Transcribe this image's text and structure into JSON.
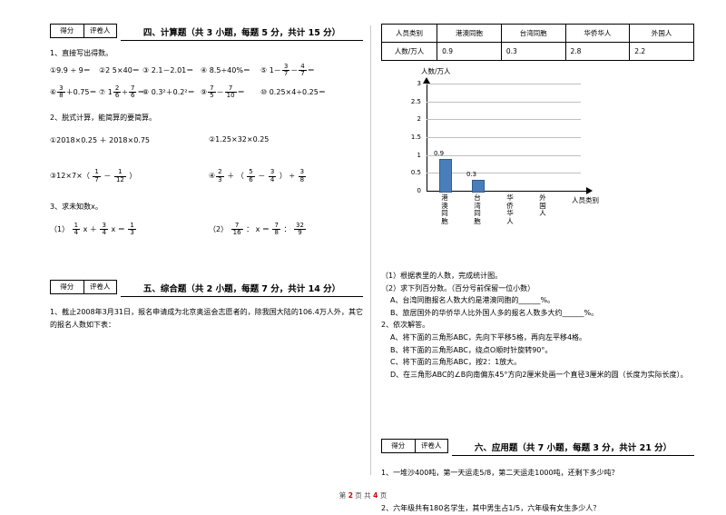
{
  "sections": {
    "four": {
      "score_label": "得分",
      "marker_label": "评卷人",
      "title": "四、计算题（共 3 小题，每题 5 分，共计 15 分）",
      "q1": "1、直接写出得数。",
      "q1_items_line1": [
        "①9.9 ÷ 9＝",
        "②2 5×40＝",
        "③ 2.1－2.01＝",
        "④ 8.5÷40%＝",
        "⑤ 1－ 3/7 － 4/7 ＝"
      ],
      "q1_items_line2": [
        "⑥ 3/8 ＋0.75＝",
        "⑦ 1 2/6 ÷ 7/6 ＝",
        "⑧ 0.3²＋0.2²＝",
        "⑨ 7/5 － 7/10 ＝",
        "⑩ 0.25×4÷0.25＝"
      ],
      "q2": "2、脱式计算，能简算的要简算。",
      "q2_a": "①2018×0.25 ＋ 2018×0.75",
      "q2_b": "②1.25×32×0.25",
      "q2_c": "③12×7×（ 1/7 － 1/12 ）",
      "q2_d": "④ 2/3 ＋ （ 5/6 － 3/4 ） ÷ 3/8",
      "q3": "3、求未知数x。",
      "q3_a": "（1） 1/4 x ＋ 3/4 x ＝ 1/3",
      "q3_b": "（2） 7/16 ： x ＝ 7/8 ： 32/9"
    },
    "five": {
      "score_label": "得分",
      "marker_label": "评卷人",
      "title": "五、综合题（共 2 小题，每题 7 分，共计 14 分）",
      "q1": "1、截止2008年3月31日，报名申请成为北京奥运会志愿者的，除我国大陆的106.4万人外，其它的报名人数如下表："
    },
    "six": {
      "score_label": "得分",
      "marker_label": "评卷人",
      "title": "六、应用题（共 7 小题，每题 3 分，共计 21 分）",
      "q1": "1、一堆沙400吨，第一天运走5/8，第二天运走1000吨，还剩下多少吨？",
      "q2": "2、六年级共有180名学生，其中男生占1/5，六年级有女生多少人？"
    }
  },
  "table": {
    "headers": [
      "人员类别",
      "港澳同胞",
      "台湾同胞",
      "华侨华人",
      "外国人"
    ],
    "row_label": "人数/万人",
    "values": [
      "0.9",
      "0.3",
      "2.8",
      "2.2"
    ]
  },
  "chart_data": {
    "type": "bar",
    "title": "",
    "ylabel": "人数/万人",
    "xlabel": "人员类别",
    "categories": [
      "港澳同胞",
      "台湾同胞",
      "华侨华人",
      "外国人"
    ],
    "values": [
      0.9,
      0.3,
      null,
      null
    ],
    "value_labels": [
      "0.9",
      "0.3",
      "",
      ""
    ],
    "yticks": [
      "0",
      "0.5",
      "1",
      "1.5",
      "2",
      "2.5",
      "3"
    ],
    "ylim": [
      0,
      3
    ],
    "grid": true,
    "legend": "none",
    "bar_color": "#4a7ebb"
  },
  "questions_right": {
    "item1": "（1）根据表里的人数，完成统计图。",
    "item2": "（2）求下列百分数。（百分号前保留一位小数）",
    "itemA": "A、台湾同胞报名人数大约是港澳同胞的______%。",
    "itemB": "B、旅居国外的华侨华人比外国人多的报名人数多大约______%。",
    "q2": "2、依次解答。",
    "q2A": "A、将下面的三角形ABC，先向下平移5格，再向左平移4格。",
    "q2B": "B、将下面的三角形ABC，绕点O顺时针旋转90°。",
    "q2C": "C、将下面的三角形ABC，按2：1放大。",
    "q2D": "D、在三角形ABC的∠B向南偏东45°方向2厘米处画一个直径3厘米的圆（长度为实际长度）。"
  },
  "footer": {
    "prefix": "第",
    "page": "2",
    "mid": "页 共",
    "total": "4",
    "suffix": "页"
  }
}
